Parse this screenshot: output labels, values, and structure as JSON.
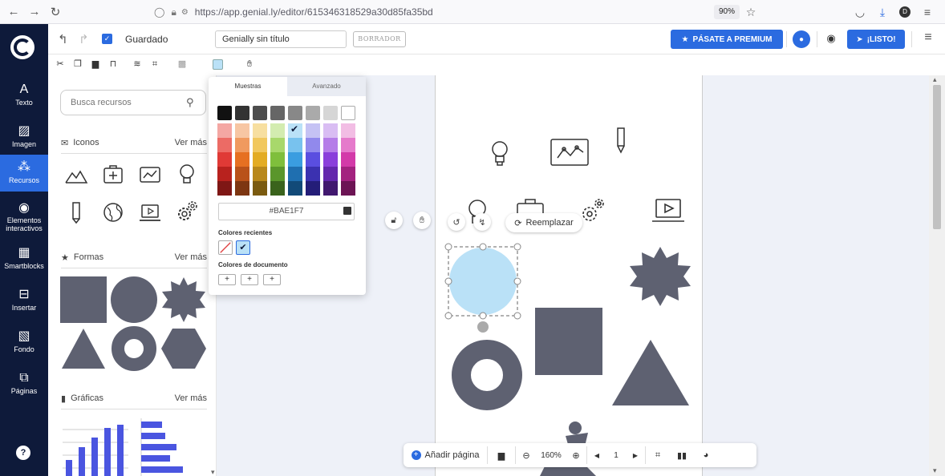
{
  "browser": {
    "url": "https://app.genial.ly/editor/615346318529a30d85fa35bd",
    "zoom": "90%"
  },
  "rail": {
    "items": [
      {
        "label": "Texto",
        "icon": "text-icon"
      },
      {
        "label": "Imagen",
        "icon": "image-icon"
      },
      {
        "label": "Recursos",
        "icon": "resources-icon"
      },
      {
        "label": "Elementos interactivos",
        "icon": "interactive-icon"
      },
      {
        "label": "Smartblocks",
        "icon": "smartblocks-icon"
      },
      {
        "label": "Insertar",
        "icon": "insert-icon"
      },
      {
        "label": "Fondo",
        "icon": "background-icon"
      },
      {
        "label": "Páginas",
        "icon": "pages-icon"
      }
    ]
  },
  "header": {
    "saved_label": "Guardado",
    "title_value": "Genially sin título",
    "draft_badge": "BORRADOR",
    "premium_label": "PÁSATE A PREMIUM",
    "ready_label": "¡LISTO!"
  },
  "sidebar": {
    "search_placeholder": "Busca recursos",
    "icons_section": "Iconos",
    "shapes_section": "Formas",
    "charts_section": "Gráficas",
    "see_more": "Ver más"
  },
  "picker": {
    "tab_samples": "Muestras",
    "tab_advanced": "Avanzado",
    "hex_value": "#BAE1F7",
    "recent_label": "Colores recientes",
    "document_label": "Colores de documento",
    "selected_color": "#BAE1F7"
  },
  "canvas": {
    "replace_label": "Reemplazar"
  },
  "bottom": {
    "add_page_label": "Añadir página",
    "zoom": "160%",
    "page_number": "1"
  }
}
